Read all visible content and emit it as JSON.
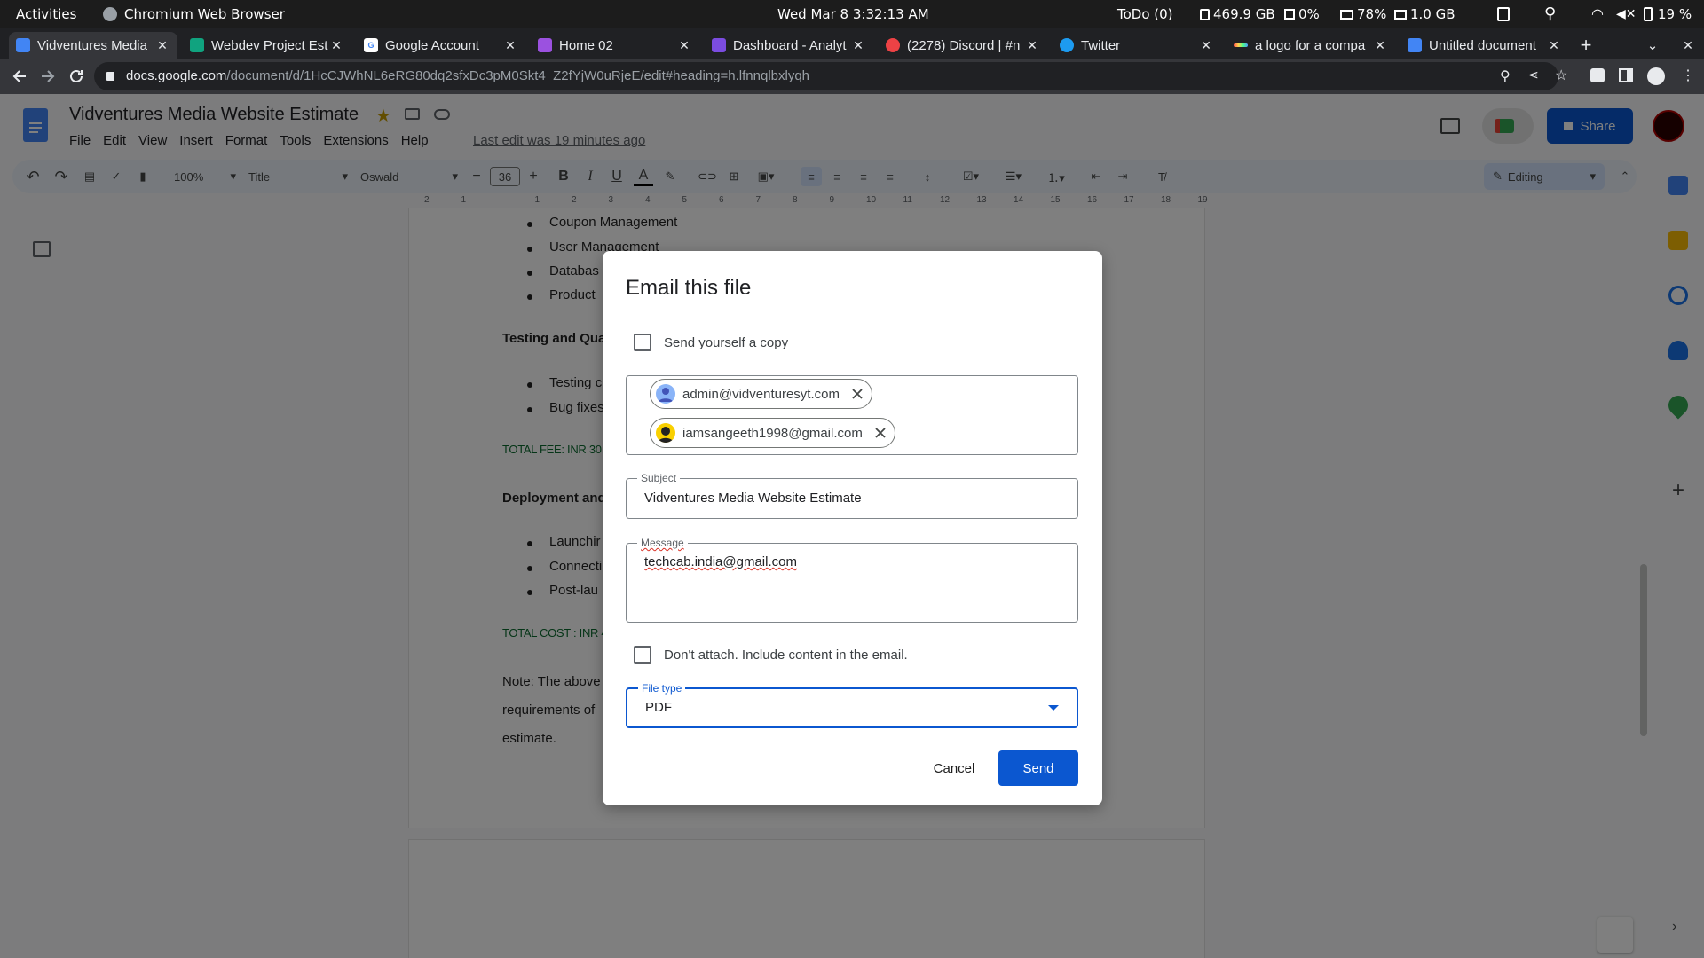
{
  "topbar": {
    "activities": "Activities",
    "app_name": "Chromium Web Browser",
    "clock": "Wed Mar 8   3:32:13 AM",
    "todo": "ToDo (0)",
    "disk": "469.9 GB",
    "cpu": "0%",
    "mem": "78%",
    "swap": "1.0 GB",
    "battery": "19 %"
  },
  "tabs": [
    {
      "title": "Vidventures Media",
      "icon_color": "#4285f4",
      "active": true
    },
    {
      "title": "Webdev Project Est",
      "icon_color": "#10a37f"
    },
    {
      "title": "Google Account",
      "icon_color": "#ffffff"
    },
    {
      "title": "Home 02",
      "icon_color": "#9b51e0"
    },
    {
      "title": "Dashboard - Analyt",
      "icon_color": "#7b4ce0"
    },
    {
      "title": "(2278) Discord | #n",
      "icon_color": "#ed4245"
    },
    {
      "title": "Twitter",
      "icon_color": "#1d9bf0"
    },
    {
      "title": "a logo for a compa",
      "icon_color": "#7b61ff"
    },
    {
      "title": "Untitled document",
      "icon_color": "#4285f4"
    }
  ],
  "address": {
    "host": "docs.google.com",
    "path": "/document/d/1HcCJWhNL6eRG80dq2sfxDc3pM0Skt4_Z2fYjW0uRjeE/edit#heading=h.lfnnqlbxlyqh"
  },
  "docs": {
    "title": "Vidventures Media Website Estimate",
    "menus": [
      "File",
      "Edit",
      "View",
      "Insert",
      "Format",
      "Tools",
      "Extensions",
      "Help"
    ],
    "last_edit": "Last edit was 19 minutes ago",
    "share_label": "Share",
    "toolbar": {
      "zoom": "100%",
      "style": "Title",
      "font": "Oswald",
      "font_size": "36",
      "mode": "Editing"
    },
    "ruler": [
      "2",
      "1",
      "",
      "1",
      "2",
      "3",
      "4",
      "5",
      "6",
      "7",
      "8",
      "9",
      "10",
      "11",
      "12",
      "13",
      "14",
      "15",
      "16",
      "17",
      "18",
      "19"
    ]
  },
  "document": {
    "bullets_top": [
      "Coupon Management",
      "User Management",
      "Databas",
      "Product"
    ],
    "testing_heading": "Testing and Qua",
    "testing_bullets": [
      "Testing c",
      "Bug fixes"
    ],
    "total_fee": "TOTAL FEE: INR 30,00",
    "deploy_heading": "Deployment and",
    "deploy_bullets": [
      "Launchir",
      "Connecti",
      "Post-lau"
    ],
    "total_cost": "TOTAL COST : INR 40",
    "note_lines": [
      "Note: The above",
      "requirements of",
      "estimate."
    ]
  },
  "dialog": {
    "title": "Email this file",
    "send_copy_label": "Send yourself a copy",
    "recipients": [
      "admin@vidventuresyt.com",
      "iamsangeeth1998@gmail.com"
    ],
    "subject_label": "Subject",
    "subject_value": "Vidventures Media Website Estimate",
    "message_label": "Message",
    "message_value": "techcab.india@gmail.com",
    "no_attach_label": "Don't attach. Include content in the email.",
    "file_type_label": "File type",
    "file_type_value": "PDF",
    "cancel_label": "Cancel",
    "send_label": "Send"
  },
  "colors": {
    "accent": "#0b57d0",
    "green_text": "#0b6b2f"
  }
}
